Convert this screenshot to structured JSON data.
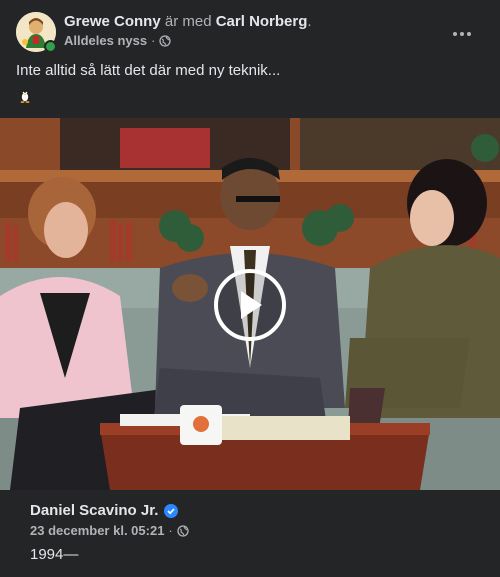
{
  "post": {
    "author": "Grewe Conny",
    "with_text": "är med",
    "tagged": "Carl Norberg",
    "period": ".",
    "timestamp": "Alldeles nyss",
    "separator": "·",
    "audience_icon": "globe-icon",
    "more_icon": "more-horizontal-icon",
    "text": "Inte alltid så lätt det där med ny teknik...",
    "emoji_icon": "penguin-emoji"
  },
  "video": {
    "play_icon": "play-icon"
  },
  "shared": {
    "author": "Daniel Scavino Jr.",
    "verified_icon": "verified-badge-icon",
    "timestamp": "23 december kl. 05:21",
    "separator": "·",
    "audience_icon": "globe-icon",
    "text": "1994—"
  },
  "colors": {
    "background": "#242526",
    "primary_text": "#e4e6eb",
    "secondary_text": "#b0b3b8",
    "online": "#31a24c",
    "verified": "#2d88ff"
  }
}
